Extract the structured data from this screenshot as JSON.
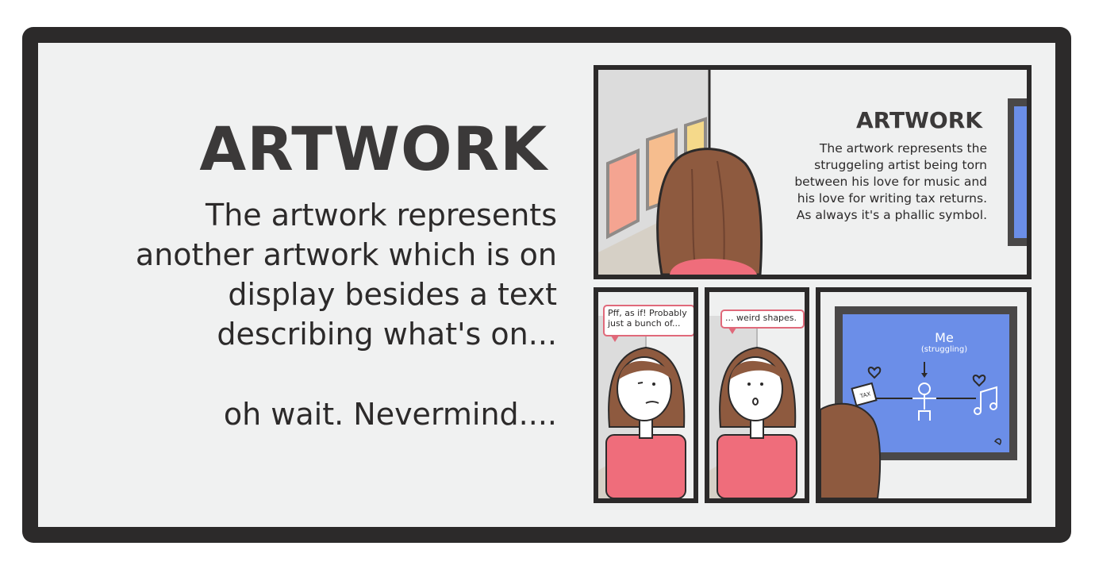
{
  "comic": {
    "headline": "ARTWORK",
    "body": "The artwork represents\nanother artwork which is on\ndisplay besides a text\ndescribing what's on...",
    "punchline": "oh wait. Nevermind...."
  },
  "panel1": {
    "caption_title": "ARTWORK",
    "caption_text": "The artwork represents the\nstruggeling artist being torn\nbetween his love for music and\nhis love for writing tax returns.\nAs always it's a phallic symbol."
  },
  "panel2": {
    "speech": "Pff, as if! Probably\njust a bunch of..."
  },
  "panel3": {
    "speech": "... weird shapes."
  },
  "panel4": {
    "artwork_label": "Me",
    "artwork_sublabel": "(struggling)",
    "tax_label": "TAX"
  },
  "colors": {
    "frame": "#2c2a2a",
    "background": "#f0f1f1",
    "hair": "#8e5a3f",
    "shirt": "#ef6d7b",
    "bubble_border": "#e0697a",
    "artwork_blue": "#6b8ee8"
  }
}
